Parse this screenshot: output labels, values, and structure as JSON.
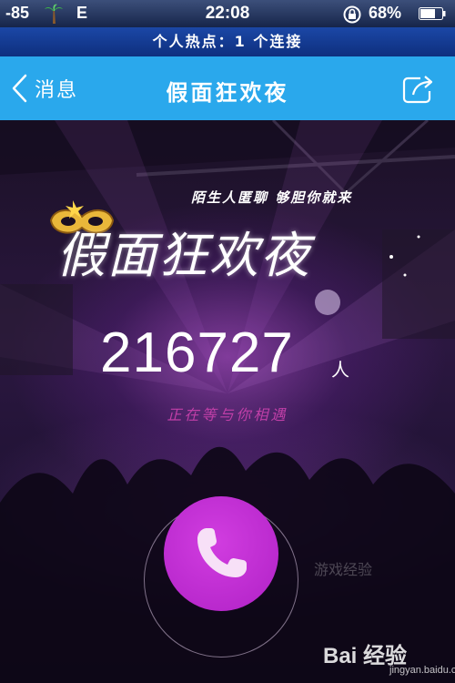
{
  "status_bar": {
    "signal": "-85",
    "network": "E",
    "time": "22:08",
    "battery": "68%",
    "icons": [
      "palm-tree-icon",
      "rotation-lock-icon",
      "battery-icon"
    ]
  },
  "hotspot_banner": "个人热点：1 个连接",
  "nav": {
    "back_label": "消息",
    "title": "假面狂欢夜",
    "share_icon": "share-icon"
  },
  "main": {
    "slogan": "陌生人匿聊 够胆你就来",
    "brand_title": "假面狂欢夜",
    "online_count": "216727",
    "count_unit": "人",
    "tagline": "正在等与你相遇",
    "call_icon": "phone-icon"
  },
  "watermark": {
    "text": "Bai 经验",
    "url": "jingyan.baidu.com",
    "faint": "游戏经验"
  },
  "colors": {
    "nav_bg": "#2aa8ec",
    "hotspot_bg": "#1b47a6",
    "call_button": "#c12fd6",
    "tagline": "#c03fa8"
  }
}
